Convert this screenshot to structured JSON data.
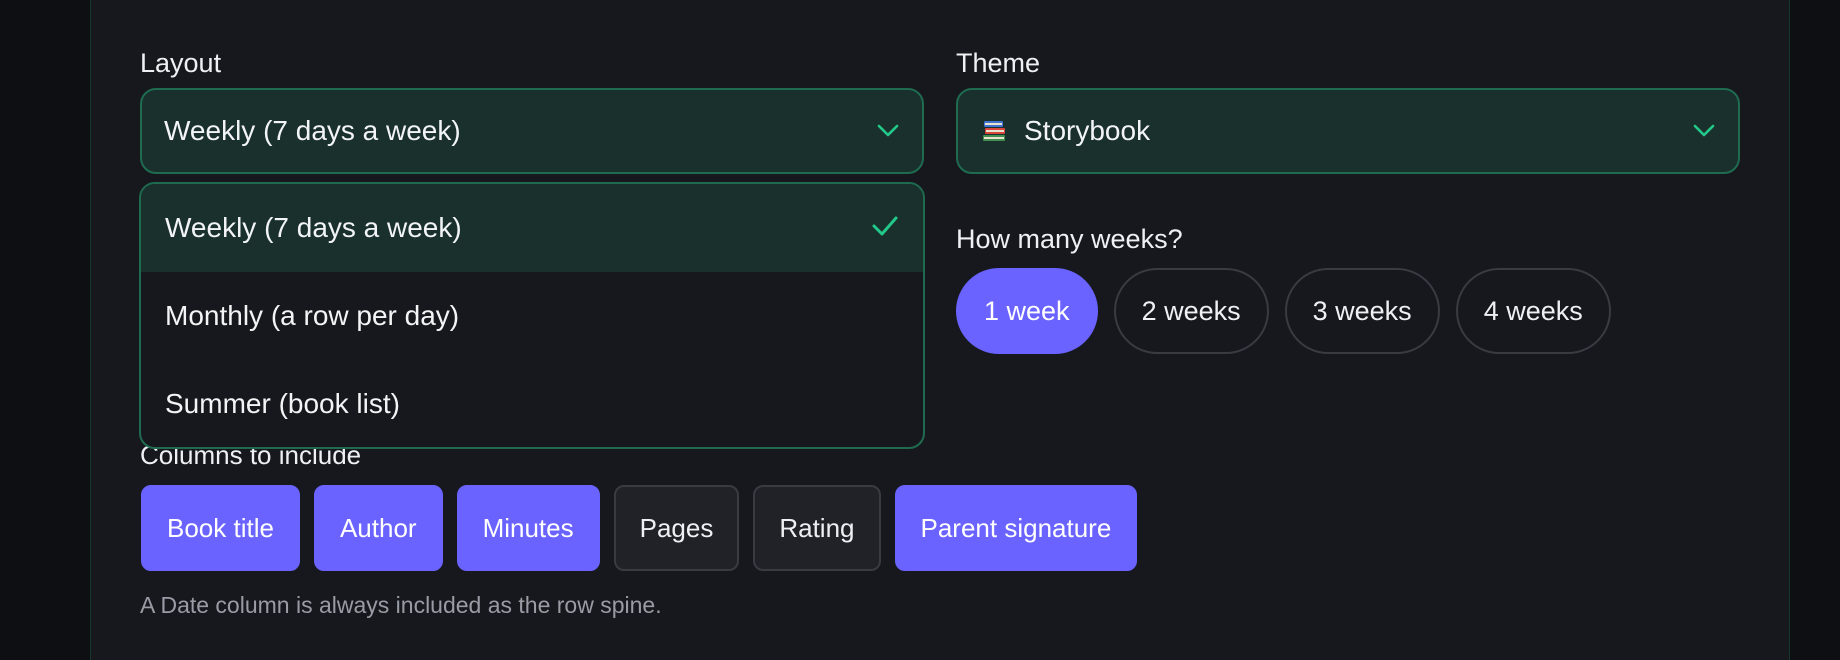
{
  "layout": {
    "label": "Layout",
    "selected": "Weekly (7 days a week)",
    "options": [
      {
        "label": "Weekly (7 days a week)",
        "selected": true
      },
      {
        "label": "Monthly (a row per day)",
        "selected": false
      },
      {
        "label": "Summer (book list)",
        "selected": false
      }
    ]
  },
  "theme": {
    "label": "Theme",
    "selected": "Storybook",
    "icon": "books-icon"
  },
  "weeks": {
    "label": "How many weeks?",
    "options": [
      {
        "label": "1 week",
        "active": true
      },
      {
        "label": "2 weeks",
        "active": false
      },
      {
        "label": "3 weeks",
        "active": false
      },
      {
        "label": "4 weeks",
        "active": false
      }
    ]
  },
  "columns": {
    "label": "Columns to include",
    "options": [
      {
        "label": "Book title",
        "on": true
      },
      {
        "label": "Author",
        "on": true
      },
      {
        "label": "Minutes",
        "on": true
      },
      {
        "label": "Pages",
        "on": false
      },
      {
        "label": "Rating",
        "on": false
      },
      {
        "label": "Parent signature",
        "on": true
      }
    ],
    "hint": "A Date column is always included as the row spine."
  },
  "colors": {
    "accent": "#6a63ff",
    "green": "#22c98a",
    "panel": "#17181e",
    "select_bg": "#19302d"
  }
}
